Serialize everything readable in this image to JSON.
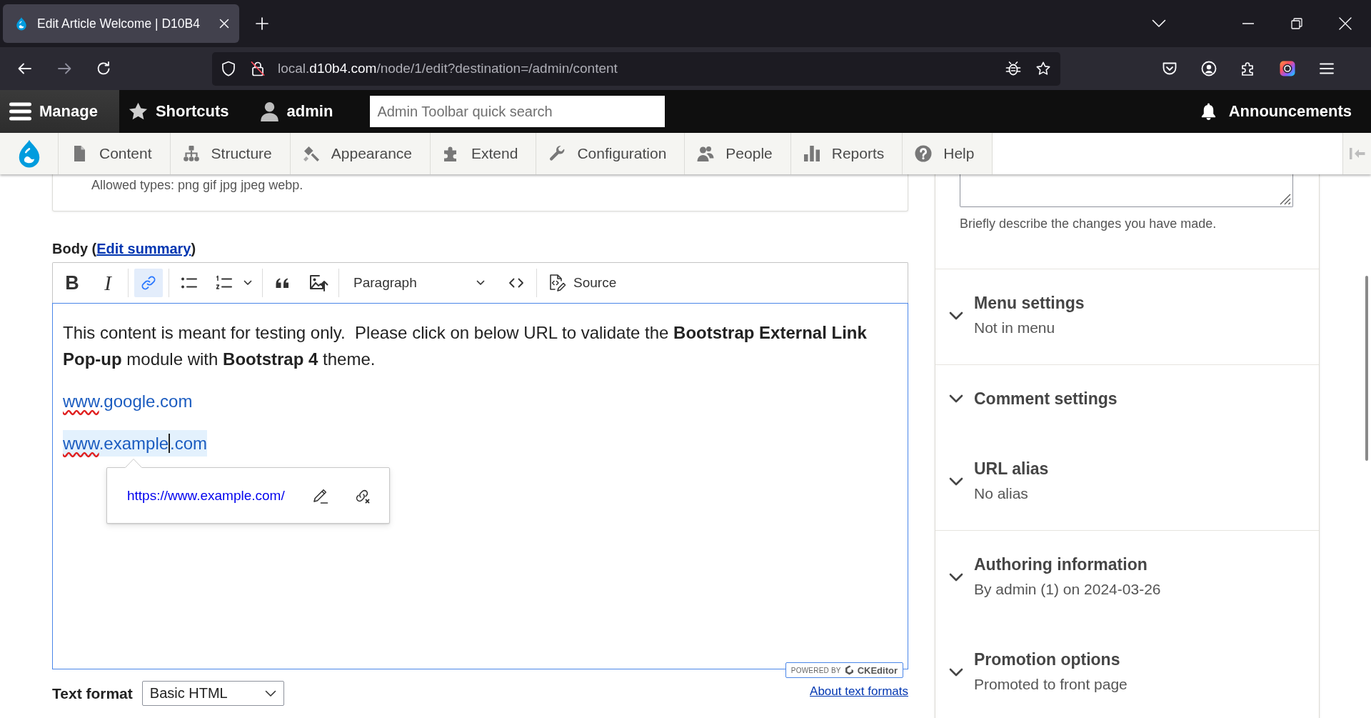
{
  "browser": {
    "tabs": [
      {
        "title": "Edit Article Welcome | D10B4",
        "selected": true
      }
    ],
    "nav_buttons": [
      {
        "disabled": false
      },
      {
        "disabled": true
      },
      {
        "disabled": false
      }
    ],
    "url": {
      "subdomain": "local.",
      "domain": "d10b4.com",
      "path": "/node/1/edit?destination=/admin/content"
    }
  },
  "admin_toolbar": {
    "items": [
      {
        "label": "Manage",
        "selected": true
      },
      {
        "label": "Shortcuts",
        "selected": false
      },
      {
        "label": "admin",
        "selected": false
      }
    ],
    "search": {
      "placeholder": "Admin Toolbar quick search"
    },
    "announcements": "Announcements"
  },
  "admin_menu": {
    "items": [
      {
        "label": "Content"
      },
      {
        "label": "Structure"
      },
      {
        "label": "Appearance"
      },
      {
        "label": "Extend"
      },
      {
        "label": "Configuration"
      },
      {
        "label": "People"
      },
      {
        "label": "Reports"
      },
      {
        "label": "Help"
      }
    ]
  },
  "upload_field": {
    "hint": "Allowed types: png gif jpg jpeg webp."
  },
  "body_field": {
    "label": "Body (",
    "link": "Edit summary",
    "label_end": ")"
  },
  "editor": {
    "toolbar": [
      {
        "items": [
          {
            "kind": "glyph",
            "glyph": "B",
            "on": false
          },
          {
            "kind": "glyph",
            "glyph": "I",
            "on": false
          }
        ]
      },
      {
        "items": [
          {
            "kind": "icon",
            "on": true
          }
        ]
      },
      {
        "items": [
          {
            "kind": "icon",
            "on": false
          },
          {
            "kind": "split",
            "on": false
          }
        ]
      },
      {
        "items": [
          {
            "kind": "icon",
            "on": false
          },
          {
            "kind": "icon",
            "on": false
          }
        ]
      },
      {
        "items": [
          {
            "kind": "dropdown",
            "value": "Paragraph"
          },
          {
            "kind": "icon",
            "on": false
          }
        ]
      },
      {
        "items": [
          {
            "kind": "labeled",
            "label": "Source",
            "on": false
          }
        ]
      }
    ],
    "content": [
      {
        "kind": "paragraph",
        "text": "This content is meant for testing only.  Please click on below URL to validate the **Bootstrap External Link Pop-up** module with **Bootstrap 4** theme."
      },
      {
        "kind": "link",
        "selected": false,
        "parts": [
          {
            "text": "www",
            "misspelled": true,
            "caret_after": false
          },
          {
            "text": ".google.com",
            "misspelled": false,
            "caret_after": false
          }
        ]
      },
      {
        "kind": "link",
        "selected": true,
        "parts": [
          {
            "text": "www",
            "misspelled": true,
            "caret_after": false
          },
          {
            "text": ".example",
            "misspelled": false,
            "caret_after": true
          },
          {
            "text": ".com",
            "misspelled": false,
            "caret_after": false
          }
        ]
      }
    ],
    "link_balloon": {
      "url": "https://www.example.com/"
    },
    "badge": {
      "prefix": "POWERED BY",
      "brand": "CKEditor"
    }
  },
  "text_format": {
    "label": "Text format",
    "value": "Basic HTML",
    "help_link": "About text formats"
  },
  "sidebar": {
    "revision_log": {
      "description": "Briefly describe the changes you have made."
    },
    "groups": [
      {
        "items": [
          {
            "title": "Menu settings",
            "summary": "Not in menu",
            "expanded": false
          }
        ]
      },
      {
        "items": [
          {
            "title": "Comment settings",
            "expanded": false
          },
          {
            "title": "URL alias",
            "summary": "No alias",
            "expanded": false
          }
        ]
      },
      {
        "items": [
          {
            "title": "Authoring information",
            "summary": "By admin (1) on 2024-03-26",
            "expanded": false
          },
          {
            "title": "Promotion options",
            "summary": "Promoted to front page",
            "expanded": false
          }
        ]
      }
    ]
  }
}
